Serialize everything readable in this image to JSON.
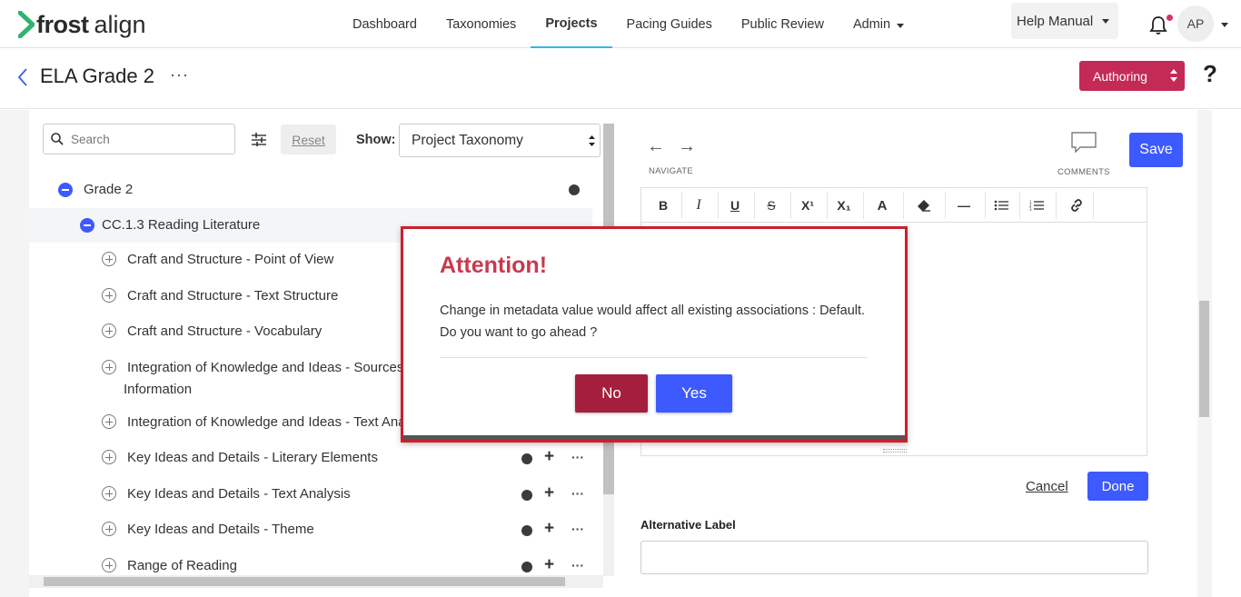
{
  "brand": {
    "name_bold": "frost",
    "name_light": "align"
  },
  "nav": {
    "items": [
      {
        "label": "Dashboard"
      },
      {
        "label": "Taxonomies"
      },
      {
        "label": "Projects"
      },
      {
        "label": "Pacing Guides"
      },
      {
        "label": "Public Review"
      },
      {
        "label": "Admin"
      }
    ],
    "help_label": "Help Manual",
    "avatar_initials": "AP",
    "accent_color": "#3ab5e6",
    "notification_color": "#d6336c"
  },
  "header": {
    "title": "ELA Grade 2",
    "dots": "···",
    "mode_label": "Authoring",
    "mode_color": "#c42a56",
    "help_icon": "?"
  },
  "left": {
    "search_placeholder": "Search",
    "reset_label": "Reset",
    "show_label": "Show:",
    "show_value": "Project Taxonomy",
    "tree": [
      {
        "label": "Grade 2",
        "state": "expanded"
      },
      {
        "label": "CC.1.3 Reading Literature",
        "state": "expanded"
      },
      {
        "label": "Craft and Structure - Point of View",
        "state": "collapsed"
      },
      {
        "label": "Craft and Structure - Text Structure",
        "state": "collapsed"
      },
      {
        "label": "Craft and Structure - Vocabulary",
        "state": "collapsed"
      },
      {
        "label": "Integration of Knowledge and Ideas - Sources of",
        "label_line2": "Information",
        "state": "collapsed"
      },
      {
        "label": "Integration of Knowledge and Ideas - Text Analysis",
        "state": "collapsed"
      },
      {
        "label": "Key Ideas and Details - Literary Elements",
        "state": "collapsed"
      },
      {
        "label": "Key Ideas and Details - Text Analysis",
        "state": "collapsed"
      },
      {
        "label": "Key Ideas and Details - Theme",
        "state": "collapsed"
      },
      {
        "label": "Range of Reading",
        "state": "collapsed"
      }
    ]
  },
  "right": {
    "navigate_label": "NAVIGATE",
    "comments_label": "COMMENTS",
    "save_label": "Save",
    "toolbar": [
      "B",
      "I",
      "U",
      "S",
      "X¹",
      "X₁",
      "A",
      "eraser",
      "—",
      "bullets",
      "numbers",
      "link"
    ],
    "cancel_label": "Cancel",
    "done_label": "Done",
    "alt_label": "Alternative Label",
    "primary_color": "#3d5afe"
  },
  "modal": {
    "title": "Attention!",
    "message": "Change in metadata value would affect all existing associations : Default. Do you want to go ahead ?",
    "no_label": "No",
    "yes_label": "Yes",
    "border_color": "#cc1f2d",
    "no_color": "#a51f3c"
  }
}
